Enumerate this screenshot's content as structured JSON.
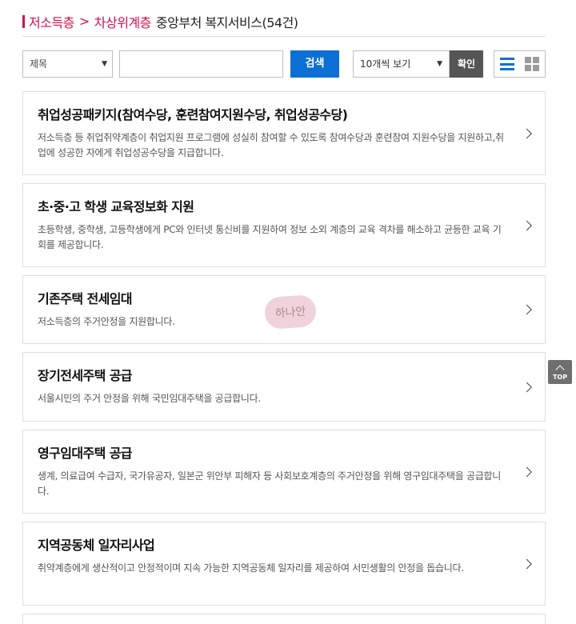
{
  "breadcrumb": {
    "level1": "저소득층",
    "separator": ">",
    "level2": "차상위계층",
    "title": "중앙부처 복지서비스(54건)"
  },
  "search": {
    "field_select": "제목",
    "input_value": "",
    "button_label": "검색"
  },
  "paging": {
    "per_page": "10개씩 보기",
    "confirm_label": "확인"
  },
  "view": {
    "list_icon": "list-view-icon",
    "grid_icon": "grid-view-icon",
    "active": "list"
  },
  "services": [
    {
      "title": "취업성공패키지(참여수당, 훈련참여지원수당, 취업성공수당)",
      "desc": "저소득층 등 취업취약계층이 취업지원 프로그램에 성실히 참여할 수 있도록 참여수당과 훈련참여 지원수당을 지원하고,취업에 성공한 자에게 취업성공수당을 지급합니다."
    },
    {
      "title": "초·중·고 학생 교육정보화 지원",
      "desc": "초등학생, 중학생, 고등학생에게 PC와 인터넷 통신비를 지원하여 정보 소외 계층의 교육 격차를 해소하고 균등한 교육 기회를 제공합니다."
    },
    {
      "title": "기존주택 전세임대",
      "desc": "저소득층의 주거안정을 지원합니다."
    },
    {
      "title": "장기전세주택 공급",
      "desc": "서울시민의 주거 안정을 위해 국민임대주택을 공급합니다."
    },
    {
      "title": "영구임대주택 공급",
      "desc": "생계, 의료급여 수급자, 국가유공자, 일본군 위안부 피해자 등 사회보호계층의 주거안정을 위해 영구임대주택을 공급합니다."
    },
    {
      "title": "지역공동체 일자리사업",
      "desc": "취약계층에게 생산적이고 안정적이며 지속 가능한 지역공동체 일자리를 제공하여 서민생활의 안정을 돕습니다."
    }
  ],
  "watermark_text": "하나안",
  "top_button": "TOP",
  "colors": {
    "accent_red": "#d70d4e",
    "primary_blue": "#0d6fd3",
    "confirm_gray": "#555555"
  }
}
